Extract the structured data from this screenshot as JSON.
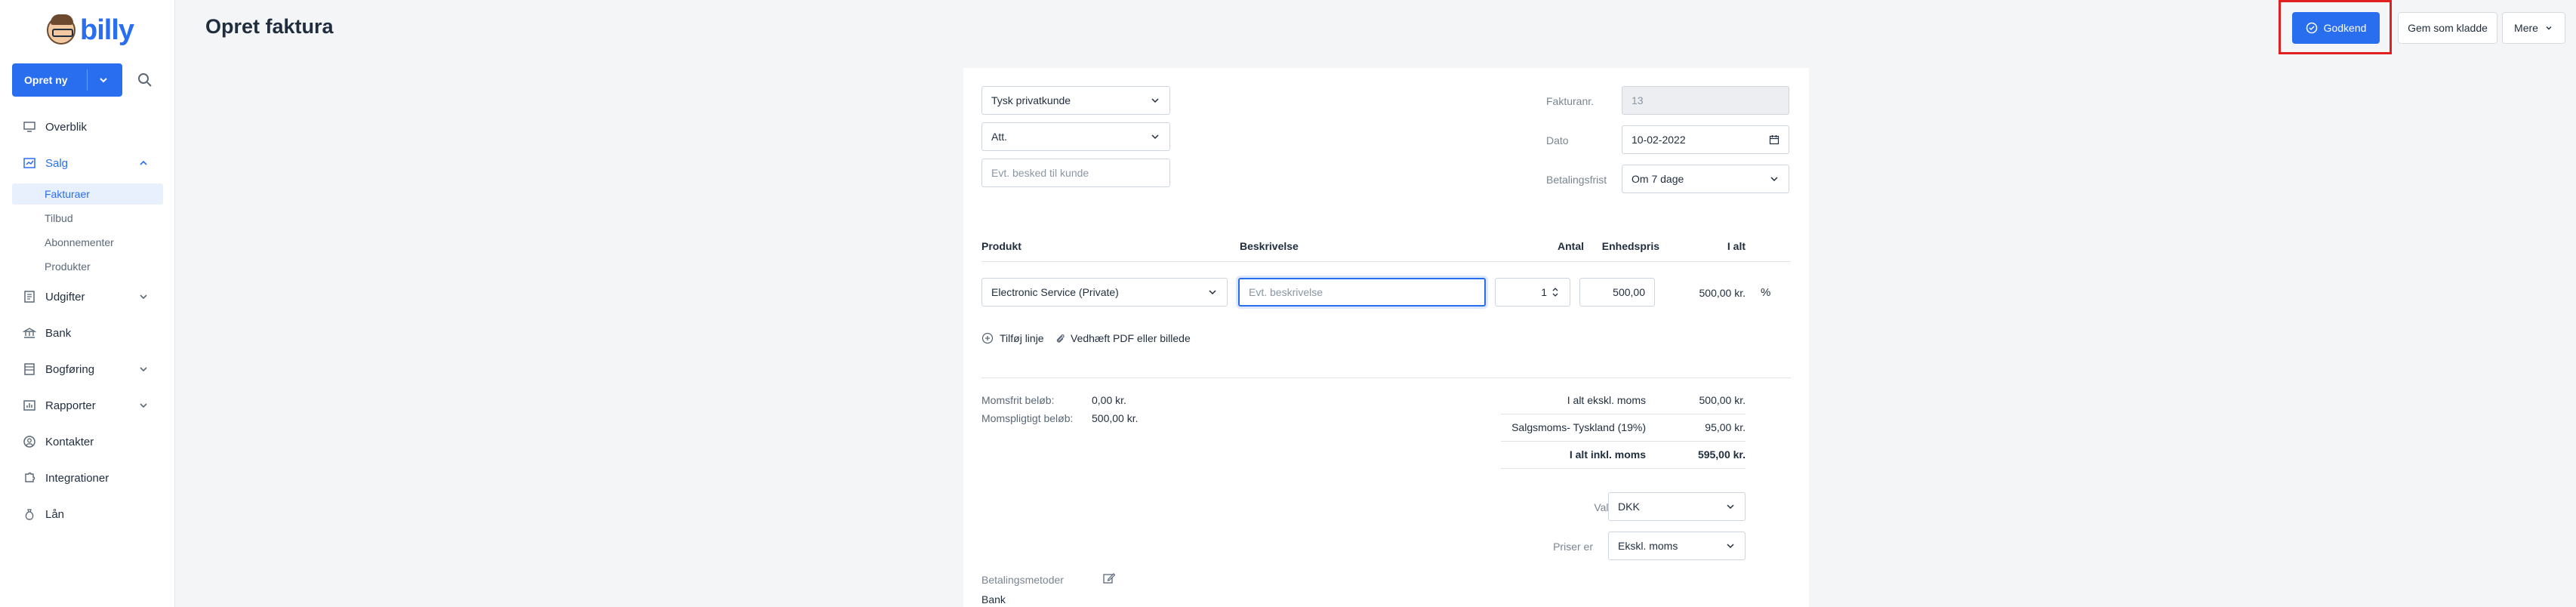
{
  "app": {
    "brand": "billy"
  },
  "sidebar": {
    "create_label": "Opret ny",
    "items": {
      "overview": "Overblik",
      "sales": "Salg",
      "invoices": "Fakturaer",
      "quotes": "Tilbud",
      "subscriptions": "Abonnementer",
      "products": "Produkter",
      "expenses": "Udgifter",
      "bank": "Bank",
      "bookkeeping": "Bogføring",
      "reports": "Rapporter",
      "contacts": "Kontakter",
      "integrations": "Integrationer",
      "loans": "Lån"
    }
  },
  "header": {
    "title": "Opret faktura",
    "approve_label": "Godkend",
    "draft_label": "Gem som kladde",
    "more_label": "Mere"
  },
  "invoice": {
    "customer": "Tysk privatkunde",
    "att": "Att.",
    "message_placeholder": "Evt. besked til kunde",
    "invoice_no_label": "Fakturanr.",
    "invoice_no": "13",
    "date_label": "Dato",
    "date": "10-02-2022",
    "due_label": "Betalingsfrist",
    "due": "Om 7 dage",
    "columns": {
      "product": "Produkt",
      "description": "Beskrivelse",
      "quantity": "Antal",
      "unit_price": "Enhedspris",
      "total": "I alt"
    },
    "line": {
      "product": "Electronic Service (Private)",
      "description_placeholder": "Evt. beskrivelse",
      "quantity": "1",
      "unit_price": "500,00",
      "total": "500,00 kr.",
      "discount_symbol": "%"
    },
    "add_line": "Tilføj linje",
    "attach": "Vedhæft PDF eller billede",
    "vat_free_label": "Momsfrit beløb:",
    "vat_free": "0,00 kr.",
    "vat_liable_label": "Momspligtigt beløb:",
    "vat_liable": "500,00 kr.",
    "subtotal_label": "I alt ekskl. moms",
    "subtotal": "500,00 kr.",
    "tax_label": "Salgsmoms- Tyskland (19%)",
    "tax": "95,00 kr.",
    "total_label": "I alt inkl. moms",
    "total": "595,00 kr.",
    "currency_label": "Valuta",
    "currency": "DKK",
    "prices_label": "Priser er",
    "prices": "Ekskl. moms",
    "payment_methods_label": "Betalingsmetoder",
    "payment_method": "Bank"
  },
  "colors": {
    "accent": "#2a6ef0",
    "highlight": "#e02020"
  }
}
